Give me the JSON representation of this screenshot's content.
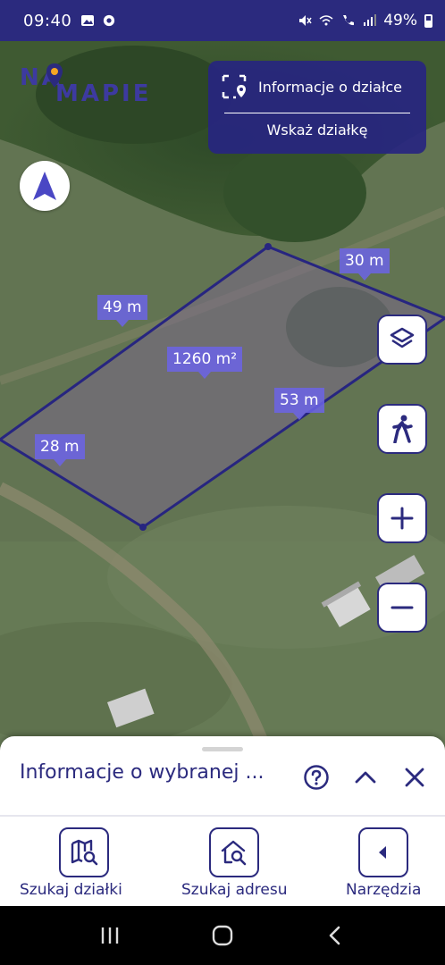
{
  "status_bar": {
    "time": "09:40",
    "battery": "49%",
    "icons": [
      "gallery-icon",
      "chrome-icon",
      "mute-icon",
      "wifi-icon",
      "call-icon",
      "signal-icon",
      "battery-icon"
    ]
  },
  "logo": {
    "line1": "NA",
    "line2": "MAPIE"
  },
  "info_panel": {
    "parcel_info_label": "Informacje o działce",
    "select_parcel_label": "Wskaż działkę"
  },
  "map": {
    "measurements": {
      "side_top": "30 m",
      "side_left_top": "49 m",
      "area": "1260 m²",
      "side_right": "53 m",
      "side_left_bottom": "28 m"
    },
    "colors": {
      "parcel_outline": "#272580",
      "label_bg": "#6c64e6"
    }
  },
  "sheet": {
    "title": "Informacje o wybranej ...",
    "icons": [
      "help-icon",
      "chevron-up-icon",
      "close-icon"
    ]
  },
  "bottom_nav": {
    "items": [
      {
        "label": "Szukaj działki",
        "icon": "map-search-icon"
      },
      {
        "label": "Szukaj adresu",
        "icon": "house-search-icon"
      },
      {
        "label": "Narzędzia",
        "icon": "chevron-left-icon"
      }
    ]
  },
  "theme": {
    "primary": "#2b2a7e",
    "accent": "#f5a623"
  }
}
